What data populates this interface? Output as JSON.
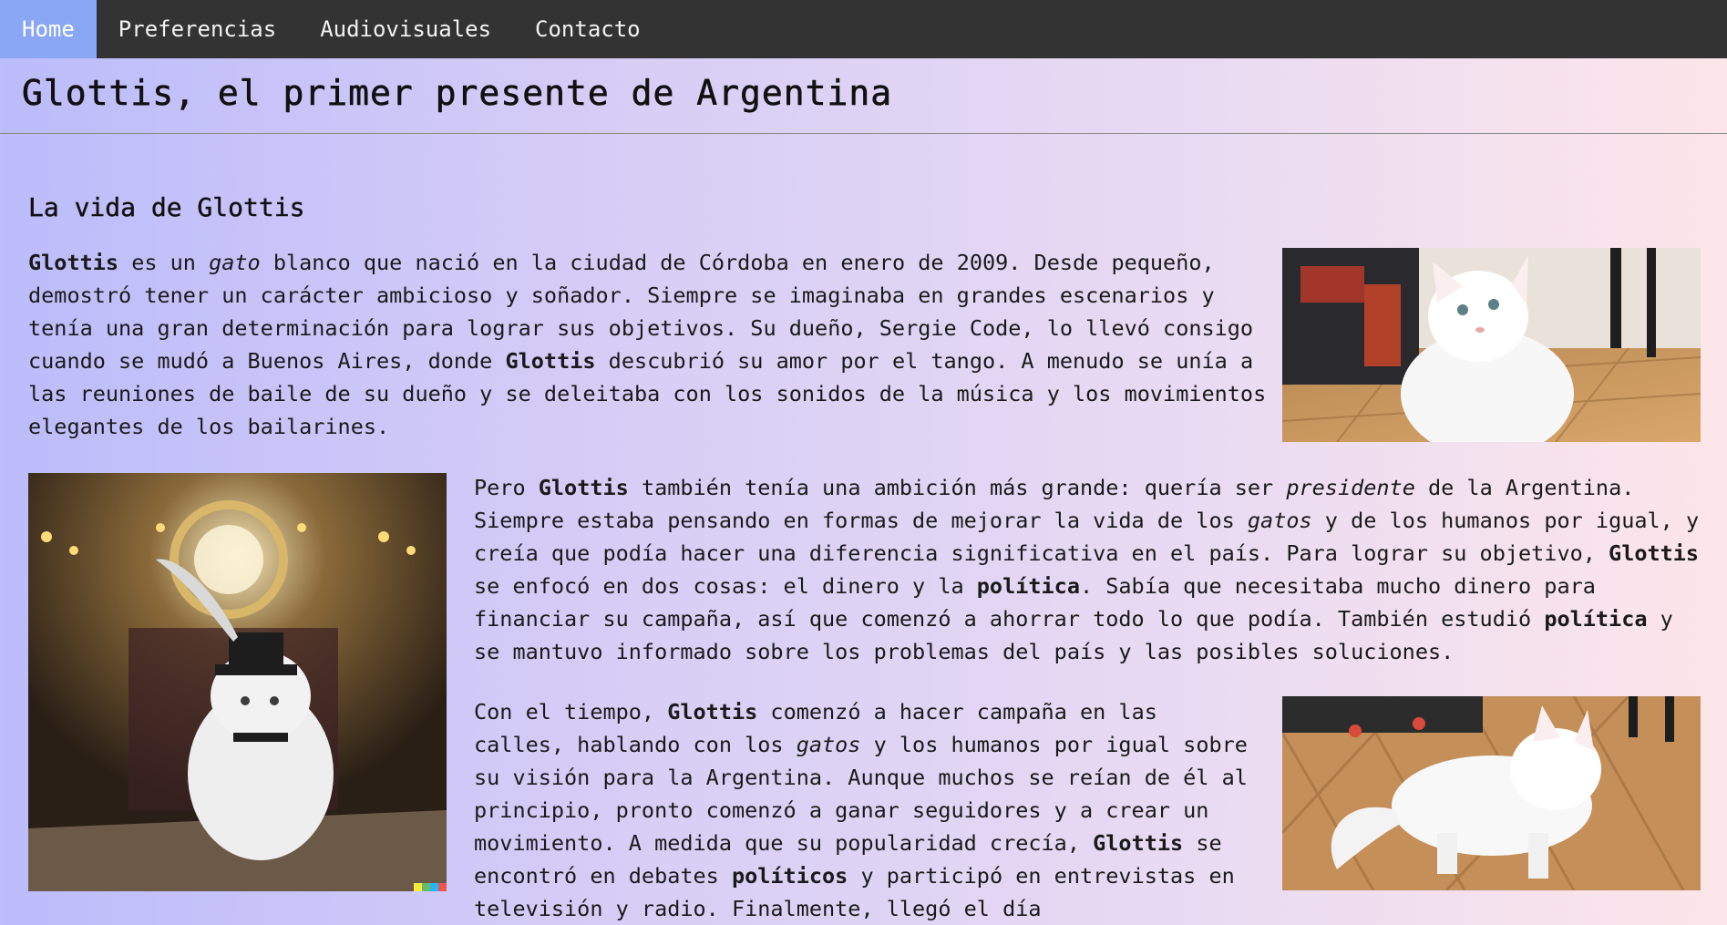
{
  "nav": {
    "items": [
      {
        "label": "Home",
        "active": true
      },
      {
        "label": "Preferencias",
        "active": false
      },
      {
        "label": "Audiovisuales",
        "active": false
      },
      {
        "label": "Contacto",
        "active": false
      }
    ]
  },
  "header": {
    "title": "Glottis, el primer presente de Argentina"
  },
  "section": {
    "heading": "La vida de Glottis"
  },
  "paragraphs": {
    "p1": [
      {
        "t": "Glottis",
        "s": "b"
      },
      {
        "t": " es un ",
        "s": ""
      },
      {
        "t": "gato",
        "s": "i"
      },
      {
        "t": " blanco que nació en la ciudad de Córdoba en enero de 2009. Desde pequeño, demostró tener un carácter ambicioso y soñador. Siempre se imaginaba en grandes escenarios y tenía una gran determinación para lograr sus objetivos. Su dueño, Sergie Code, lo llevó consigo cuando se mudó a Buenos Aires, donde ",
        "s": ""
      },
      {
        "t": "Glottis",
        "s": "b"
      },
      {
        "t": " descubrió su amor por el tango. A menudo se unía a las reuniones de baile de su dueño y se deleitaba con los sonidos de la música y los movimientos elegantes de los bailarines.",
        "s": ""
      }
    ],
    "p2": [
      {
        "t": "Pero ",
        "s": ""
      },
      {
        "t": "Glottis",
        "s": "b"
      },
      {
        "t": " también tenía una ambición más grande: quería ser ",
        "s": ""
      },
      {
        "t": "presidente",
        "s": "i"
      },
      {
        "t": " de la Argentina. Siempre estaba pensando en formas de mejorar la vida de los ",
        "s": ""
      },
      {
        "t": "gatos",
        "s": "i"
      },
      {
        "t": " y de los humanos por igual, y creía que podía hacer una diferencia significativa en el país. Para lograr su objetivo, ",
        "s": ""
      },
      {
        "t": "Glottis",
        "s": "b"
      },
      {
        "t": " se enfocó en dos cosas: el dinero y la ",
        "s": ""
      },
      {
        "t": "política",
        "s": "b"
      },
      {
        "t": ". Sabía que necesitaba mucho dinero para financiar su campaña, así que comenzó a ahorrar todo lo que podía. También estudió ",
        "s": ""
      },
      {
        "t": "política",
        "s": "b"
      },
      {
        "t": " y se mantuvo informado sobre los problemas del país y las posibles soluciones.",
        "s": ""
      }
    ],
    "p3": [
      {
        "t": "Con el tiempo, ",
        "s": ""
      },
      {
        "t": "Glottis",
        "s": "b"
      },
      {
        "t": " comenzó a hacer campaña en las calles, hablando con los ",
        "s": ""
      },
      {
        "t": "gatos",
        "s": "i"
      },
      {
        "t": " y los humanos por igual sobre su visión para la Argentina. Aunque muchos se reían de él al principio, pronto comenzó a ganar seguidores y a crear un movimiento. A medida que su popularidad crecía, ",
        "s": ""
      },
      {
        "t": "Glottis",
        "s": "b"
      },
      {
        "t": " se encontró en debates ",
        "s": ""
      },
      {
        "t": "políticos",
        "s": "b"
      },
      {
        "t": " y participó en entrevistas en televisión y radio. Finalmente, llegó el día",
        "s": ""
      }
    ]
  },
  "images": {
    "img1": "white cat looking up on wooden floor",
    "img2": "white cat wearing top hat with feather on stage",
    "img3": "white fluffy cat walking on parquet floor"
  },
  "colors": {
    "nav_bg": "#333333",
    "nav_active": "#8aa7f6",
    "page_gradient_start": "#bcbcfb",
    "page_gradient_end": "#fde6ea"
  }
}
